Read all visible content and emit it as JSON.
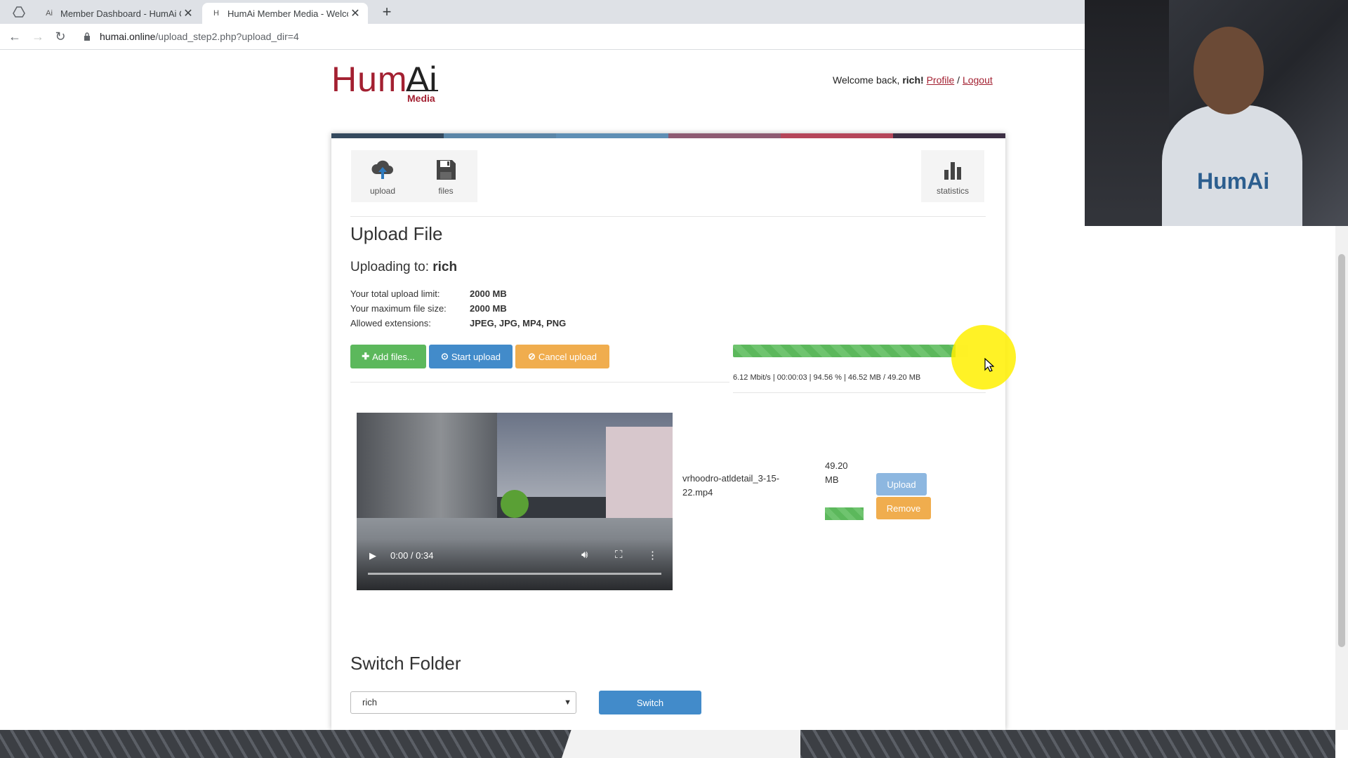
{
  "browser": {
    "tabs": [
      {
        "title": "Member Dashboard - HumAi Clu",
        "active": false
      },
      {
        "title": "HumAi Member Media - Welcom",
        "active": true
      }
    ],
    "url_host": "humai.online",
    "url_path": "/upload_step2.php?upload_dir=4"
  },
  "header": {
    "logo_hum": "Hum",
    "logo_ai": "Ai",
    "logo_media": "Media",
    "welcome_prefix": "Welcome back,",
    "username": "rich!",
    "profile_link": "Profile",
    "separator": "/",
    "logout_link": "Logout"
  },
  "nav": {
    "upload_label": "upload",
    "files_label": "files",
    "statistics_label": "statistics"
  },
  "upload": {
    "title": "Upload File",
    "to_label": "Uploading to:",
    "to_value": "rich",
    "info": [
      {
        "label": "Your total upload limit:",
        "value": "2000 MB"
      },
      {
        "label": "Your maximum file size:",
        "value": "2000 MB"
      },
      {
        "label": "Allowed extensions:",
        "value": "JPEG, JPG, MP4, PNG"
      }
    ],
    "add_files_label": "Add files...",
    "start_upload_label": "Start upload",
    "cancel_upload_label": "Cancel upload",
    "progress_percent": 94.56,
    "stats_text": "6.12 Mbit/s | 00:00:03 | 94.56 % | 46.52 MB / 49.20 MB"
  },
  "file_item": {
    "video_time": "0:00 / 0:34",
    "filename": "vrhoodro-atldetail_3-15-22.mp4",
    "size": "49.20 MB",
    "upload_label": "Upload",
    "remove_label": "Remove"
  },
  "switch_folder": {
    "title": "Switch Folder",
    "selected": "rich",
    "button_label": "Switch"
  },
  "webcam": {
    "shirt_text": "HumAi"
  },
  "colors": {
    "brand_red": "#a32031",
    "stripe": [
      "#34495e",
      "#5b86a8",
      "#5f8fb5",
      "#8e5b73",
      "#b5465a",
      "#3c2f44"
    ],
    "success": "#5cb85c",
    "primary": "#428bca",
    "warning": "#f0ad4e"
  }
}
